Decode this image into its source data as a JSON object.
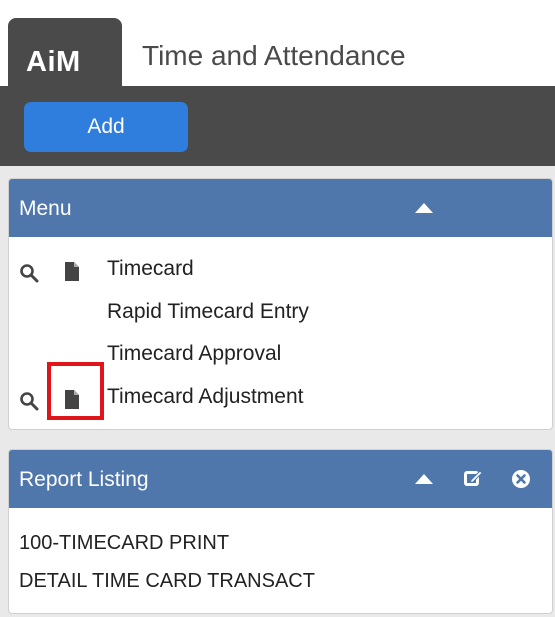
{
  "header": {
    "logo_text": "AiM",
    "app_title": "Time and Attendance"
  },
  "toolbar": {
    "add_label": "Add"
  },
  "menu_panel": {
    "title": "Menu",
    "items": [
      {
        "label": "Timecard",
        "icons": [
          "search-icon",
          "document-icon"
        ]
      },
      {
        "label": "Rapid Timecard Entry",
        "icons": []
      },
      {
        "label": "Timecard Approval",
        "icons": []
      },
      {
        "label": "Timecard Adjustment",
        "icons": [
          "search-icon",
          "document-icon"
        ],
        "highlighted_icon": "document-icon"
      }
    ]
  },
  "report_panel": {
    "title": "Report Listing",
    "header_icons": [
      "collapse-arrow-icon",
      "edit-icon",
      "close-icon"
    ],
    "items": [
      {
        "label": "100-TIMECARD PRINT"
      },
      {
        "label": "DETAIL TIME CARD TRANSACT"
      }
    ]
  },
  "colors": {
    "header_dark": "#4a4a4a",
    "add_button": "#2f7ddd",
    "panel_header": "#4f77ab",
    "highlight": "#e0151b"
  }
}
